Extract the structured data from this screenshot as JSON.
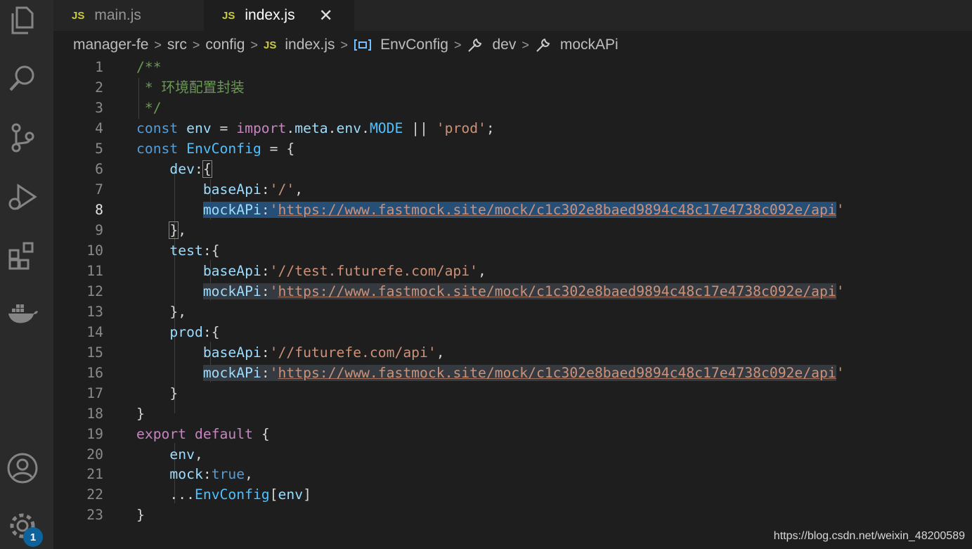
{
  "tabs": [
    {
      "icon": "JS",
      "label": "main.js",
      "active": false
    },
    {
      "icon": "JS",
      "label": "index.js",
      "active": true,
      "close": "✕"
    }
  ],
  "breadcrumb": {
    "items": [
      "manager-fe",
      "src",
      "config",
      "index.js",
      "EnvConfig",
      "dev",
      "mockAPi"
    ],
    "file_icon": "JS"
  },
  "editor": {
    "line_numbers": [
      "1",
      "2",
      "3",
      "4",
      "5",
      "6",
      "7",
      "8",
      "9",
      "10",
      "11",
      "12",
      "13",
      "14",
      "15",
      "16",
      "17",
      "18",
      "19",
      "20",
      "21",
      "22",
      "23"
    ],
    "current_line": "8",
    "url": "https://www.fastmock.site/mock/c1c302e8baed9894c48c17e4738c092e/api",
    "comment_text": "* 环境配置封装"
  },
  "activity_bar": {
    "icons": [
      "files-icon",
      "search-icon",
      "source-control-icon",
      "run-debug-icon",
      "extensions-icon",
      "docker-icon",
      "account-icon",
      "settings-icon"
    ],
    "settings_badge": "1"
  },
  "watermark": "https://blog.csdn.net/weixin_48200589",
  "colors": {
    "background": "#1e1e1e",
    "activity_bar": "#2a2a2a",
    "selection": "#264f78",
    "badge": "#0e639c"
  }
}
